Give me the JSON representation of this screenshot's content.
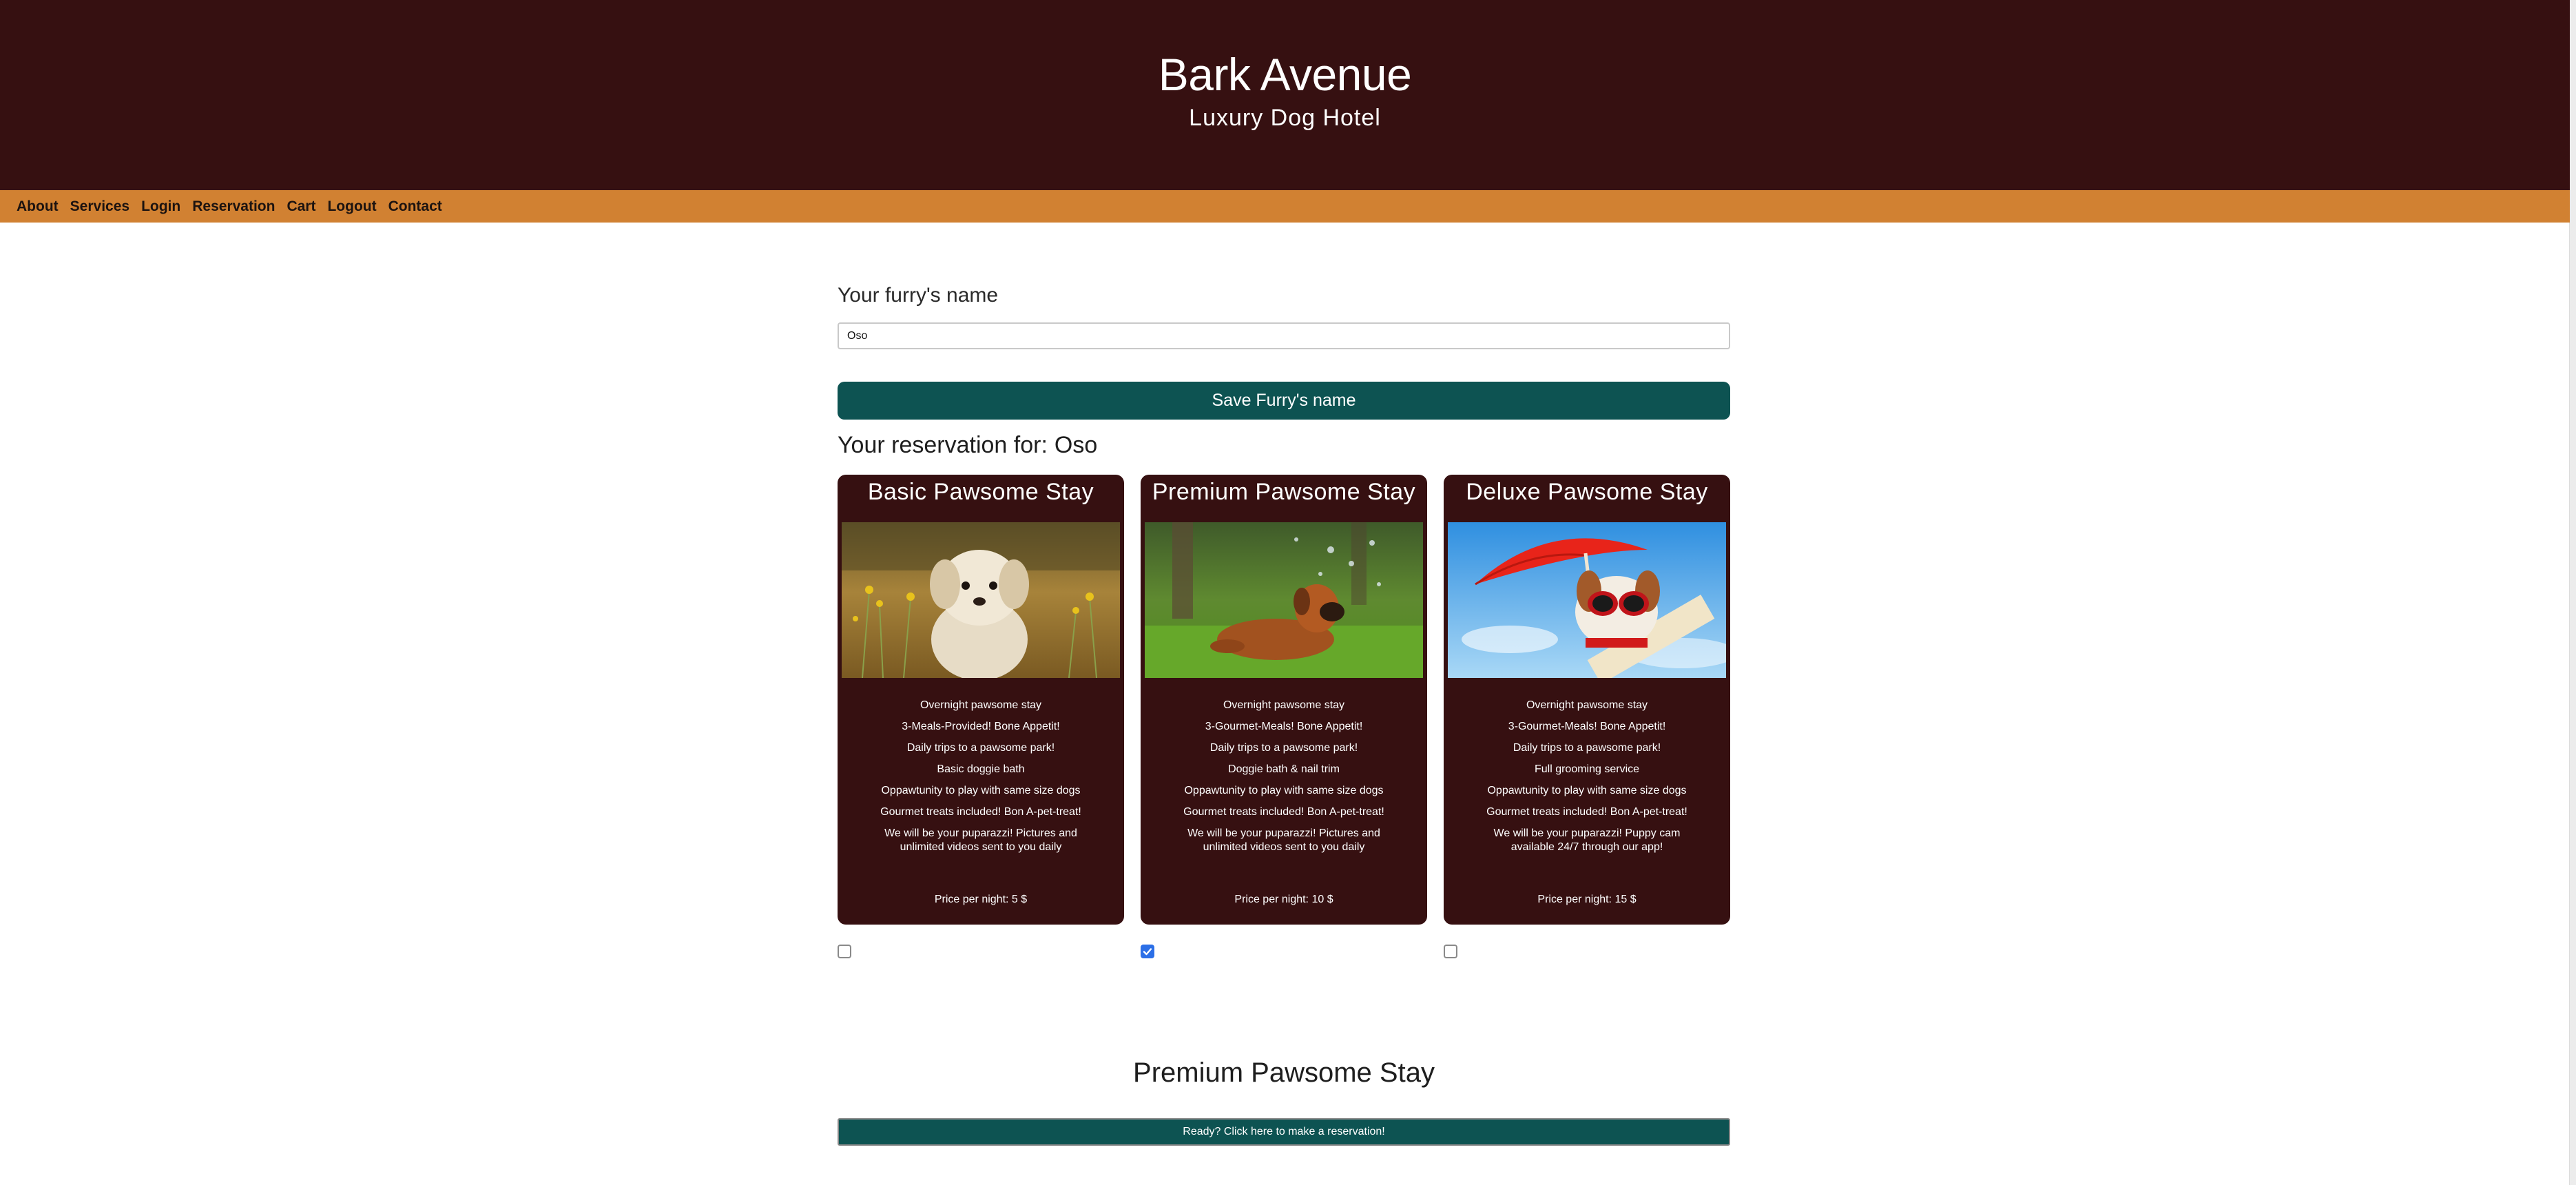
{
  "header": {
    "title": "Bark Avenue",
    "subtitle": "Luxury Dog Hotel"
  },
  "nav": {
    "items": [
      "About",
      "Services",
      "Login",
      "Reservation",
      "Cart",
      "Logout",
      "Contact"
    ]
  },
  "form": {
    "name_label": "Your furry's name",
    "name_value": "Oso",
    "save_button": "Save Furry's name"
  },
  "reservation": {
    "heading_prefix": "Your reservation for:",
    "pet_name": "Oso"
  },
  "cards": [
    {
      "title": "Basic Pawsome Stay",
      "image": "fluffy-puppy-in-field",
      "features": [
        "Overnight pawsome stay",
        "3-Meals-Provided! Bone Appetit!",
        "Daily trips to a pawsome park!",
        "Basic doggie bath",
        "Oppawtunity to play with same size dogs",
        "Gourmet treats included! Bon A-pet-treat!",
        "We will be your puparazzi! Pictures and unlimited videos sent to you daily"
      ],
      "price": "Price per night: 5 $",
      "checked": false
    },
    {
      "title": "Premium Pawsome Stay",
      "image": "dog-lying-in-grass",
      "features": [
        "Overnight pawsome stay",
        "3-Gourmet-Meals! Bone Appetit!",
        "Daily trips to a pawsome park!",
        "Doggie bath & nail trim",
        "Oppawtunity to play with same size dogs",
        "Gourmet treats included! Bon A-pet-treat!",
        "We will be your puparazzi! Pictures and unlimited videos sent to you daily"
      ],
      "price": "Price per night: 10 $",
      "checked": true
    },
    {
      "title": "Deluxe Pawsome Stay",
      "image": "dog-with-sunglasses-and-umbrella",
      "features": [
        "Overnight pawsome stay",
        "3-Gourmet-Meals! Bone Appetit!",
        "Daily trips to a pawsome park!",
        "Full grooming service",
        "Oppawtunity to play with same size dogs",
        "Gourmet treats included! Bon A-pet-treat!",
        "We will be your puparazzi! Puppy cam available 24/7 through our app!"
      ],
      "price": "Price per night: 15 $",
      "checked": false
    }
  ],
  "selection": {
    "title": "Premium Pawsome Stay",
    "reserve_button": "Ready? Click here to make a reservation!"
  },
  "colors": {
    "header_bg": "#361011",
    "nav_bg": "#d18132",
    "button_bg": "#0d5352",
    "card_bg": "#361011",
    "checkbox_checked": "#2c6fe7"
  },
  "icons": {
    "checkbox_checked": "checkmark-icon"
  }
}
